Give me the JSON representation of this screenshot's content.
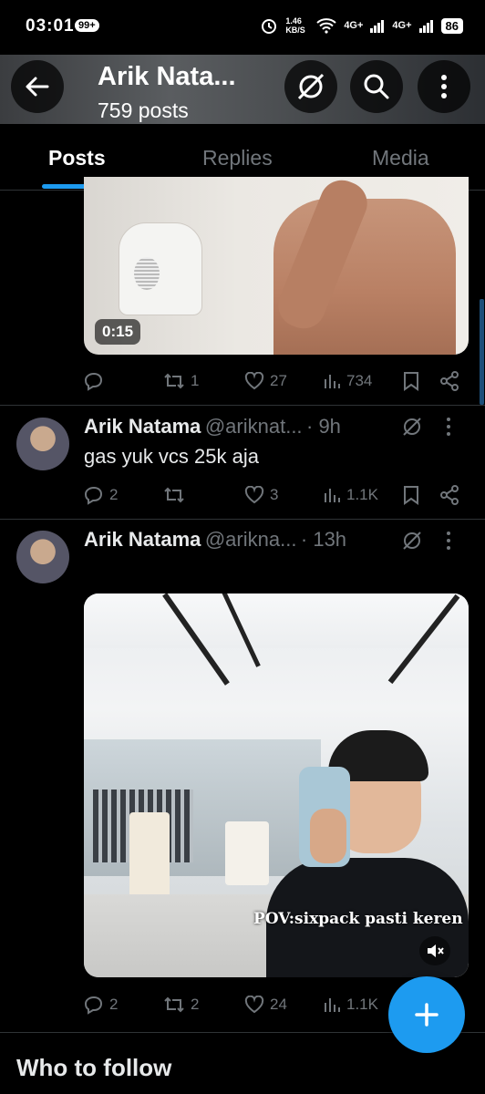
{
  "status_bar": {
    "time": "03:01",
    "notif_badge": "99+",
    "net_speed": "1.46 KB/S",
    "signal1": "4G+",
    "signal2": "4G+",
    "battery": "86"
  },
  "header": {
    "title": "Arik Nata...",
    "post_count": "759 posts",
    "back_icon": "arrow-left-icon",
    "grok_icon": "slash-circle-icon",
    "search_icon": "search-icon",
    "more_icon": "more-vertical-icon"
  },
  "tabs": [
    {
      "label": "Posts",
      "active": true
    },
    {
      "label": "Replies"
    },
    {
      "label": "Media"
    }
  ],
  "posts": [
    {
      "media": {
        "duration": "0:15"
      },
      "actions": {
        "replies": "",
        "reposts": "1",
        "likes": "27",
        "views": "734"
      }
    },
    {
      "author": "Arik Natama",
      "handle": "@ariknat...",
      "time": "· 9h",
      "text": "gas yuk vcs 25k aja",
      "actions": {
        "replies": "2",
        "reposts": "",
        "likes": "3",
        "views": "1.1K"
      }
    },
    {
      "author": "Arik Natama",
      "handle": "@arikna...",
      "time": "· 13h",
      "media": {
        "caption": "POV:sixpack pasti keren"
      },
      "actions": {
        "replies": "2",
        "reposts": "2",
        "likes": "24",
        "views": "1.1K"
      }
    }
  ],
  "who_to_follow": "Who to follow",
  "colors": {
    "accent": "#1d9bf0",
    "muted": "#71767b",
    "background": "#000000"
  }
}
